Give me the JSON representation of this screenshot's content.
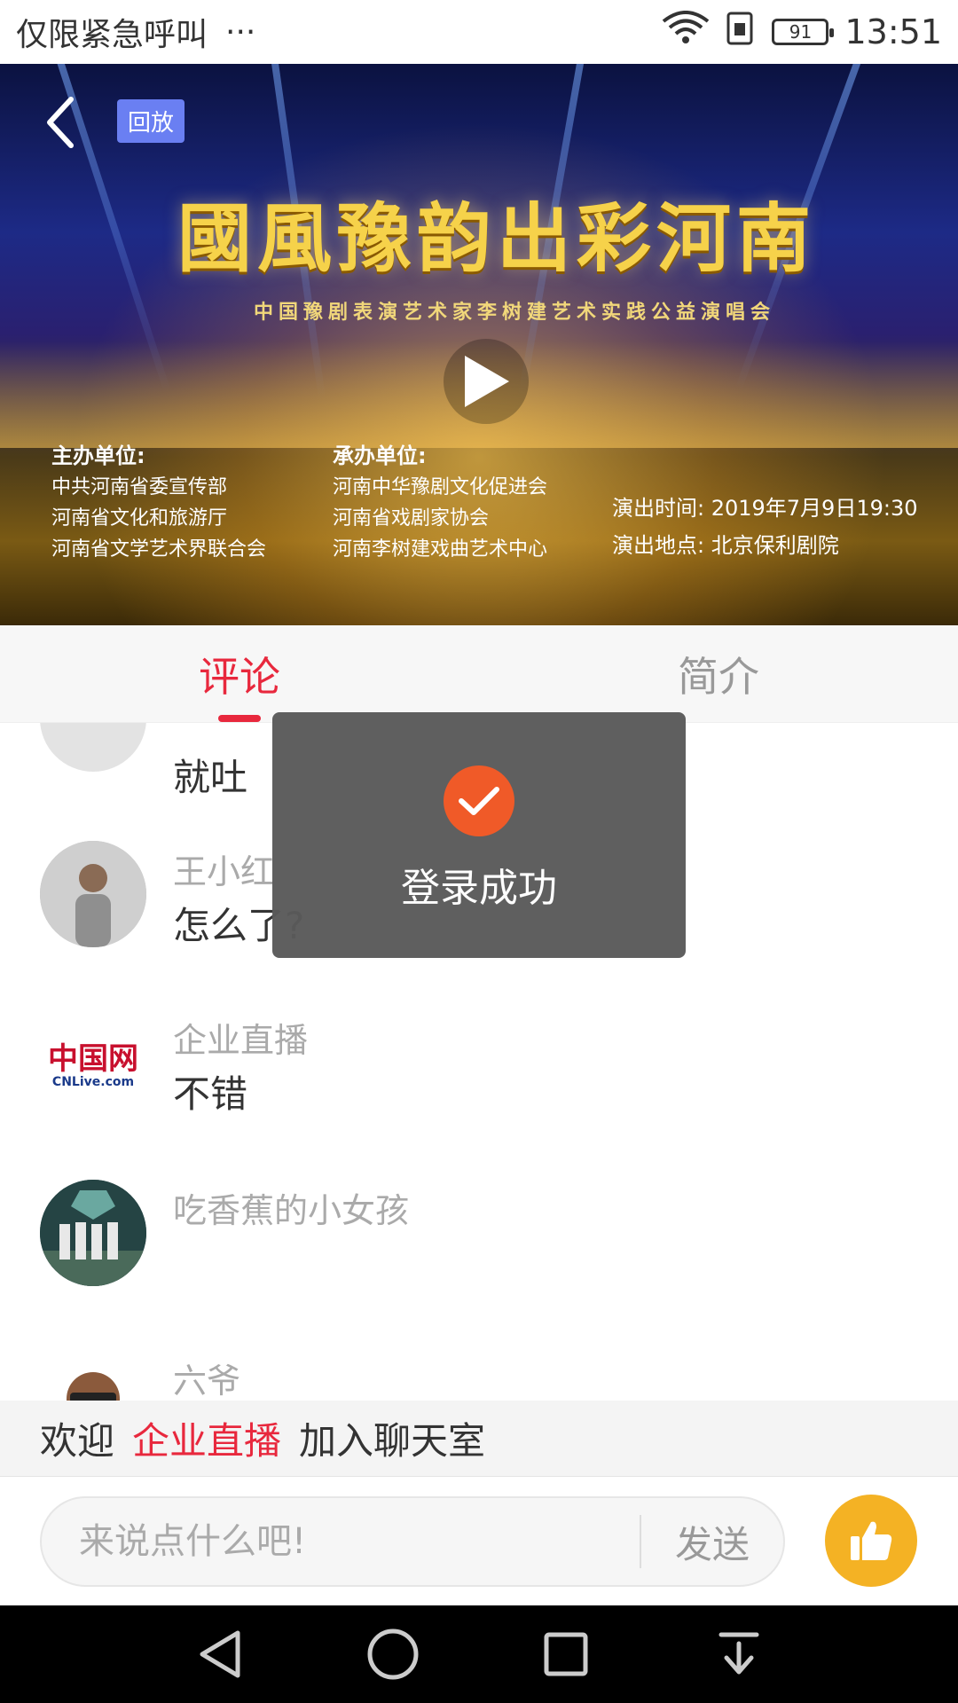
{
  "status_bar": {
    "carrier_text": "仅限紧急呼叫",
    "more": "···",
    "battery": "91",
    "time": "13:51"
  },
  "video": {
    "badge": "回放",
    "title": "國風豫韵出彩河南",
    "subtitle": "中国豫剧表演艺术家李树建艺术实践公益演唱会",
    "organizer": {
      "heading": "主办单位:",
      "lines": [
        "中共河南省委宣传部",
        "河南省文化和旅游厅",
        "河南省文学艺术界联合会"
      ]
    },
    "host": {
      "heading": "承办单位:",
      "lines": [
        "河南中华豫剧文化促进会",
        "河南省戏剧家协会",
        "河南李树建戏曲艺术中心"
      ]
    },
    "show_time": "演出时间: 2019年7月9日19:30",
    "show_place": "演出地点: 北京保利剧院"
  },
  "tabs": [
    {
      "label": "评论"
    },
    {
      "label": "简介"
    }
  ],
  "comments": [
    {
      "name": "",
      "text": "就吐"
    },
    {
      "name": "王小红",
      "text": "怎么了?"
    },
    {
      "name": "企业直播",
      "text": "不错"
    },
    {
      "name": "吃香蕉的小女孩",
      "text": ""
    },
    {
      "name": "六爷",
      "text": ""
    }
  ],
  "avatars": {
    "cnlive_logo_text": "中国网",
    "cnlive_sub": "CNLive.com"
  },
  "toast": {
    "text": "登录成功"
  },
  "welcome": {
    "prefix": "欢迎",
    "user": "企业直播",
    "suffix": "加入聊天室"
  },
  "input": {
    "placeholder": "来说点什么吧!",
    "send_label": "发送"
  },
  "colors": {
    "accent": "#e8283d",
    "like": "#f4b224",
    "toast_check": "#f05a28"
  }
}
